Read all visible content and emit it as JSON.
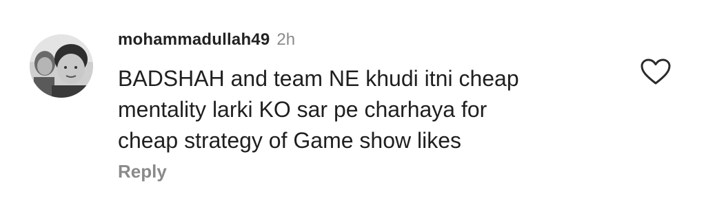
{
  "comment": {
    "username": "mohammadullah49",
    "timestamp": "2h",
    "text_lines": [
      "BADSHAH and team NE khudi itni cheap",
      "mentality larki KO sar pe charhaya for",
      "cheap strategy of Game show likes"
    ],
    "reply_label": "Reply",
    "avatar_icon": "user-avatar-photo",
    "like_icon": "heart-outline-icon",
    "colors": {
      "text": "#1f1f1f",
      "muted": "#8a8a8a",
      "background": "#ffffff"
    }
  }
}
